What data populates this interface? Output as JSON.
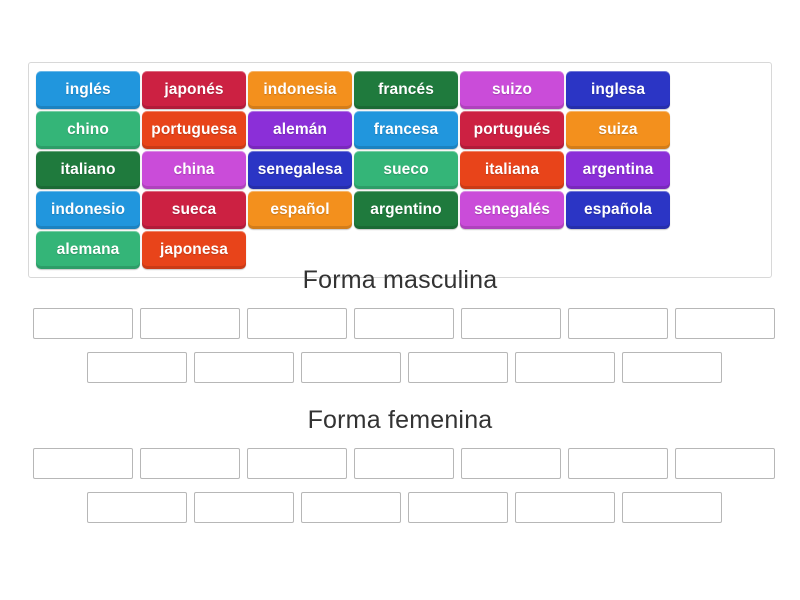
{
  "wordbank": {
    "name": "word-bank",
    "tiles": [
      {
        "label": "inglés",
        "color": "#2196dd"
      },
      {
        "label": "japonés",
        "color": "#cc2142"
      },
      {
        "label": "indonesia",
        "color": "#f3901d"
      },
      {
        "label": "francés",
        "color": "#1f7a3d"
      },
      {
        "label": "suizo",
        "color": "#ca4cd9"
      },
      {
        "label": "inglesa",
        "color": "#2b35c5"
      },
      {
        "label": "chino",
        "color": "#34b578"
      },
      {
        "label": "portuguesa",
        "color": "#e8441a"
      },
      {
        "label": "alemán",
        "color": "#8b2fd8"
      },
      {
        "label": "francesa",
        "color": "#2196dd"
      },
      {
        "label": "portugués",
        "color": "#cc2142"
      },
      {
        "label": "suiza",
        "color": "#f3901d"
      },
      {
        "label": "italiano",
        "color": "#1f7a3d"
      },
      {
        "label": "china",
        "color": "#ca4cd9"
      },
      {
        "label": "senegalesa",
        "color": "#2b35c5"
      },
      {
        "label": "sueco",
        "color": "#34b578"
      },
      {
        "label": "italiana",
        "color": "#e8441a"
      },
      {
        "label": "argentina",
        "color": "#8b2fd8"
      },
      {
        "label": "indonesio",
        "color": "#2196dd"
      },
      {
        "label": "sueca",
        "color": "#cc2142"
      },
      {
        "label": "español",
        "color": "#f3901d"
      },
      {
        "label": "argentino",
        "color": "#1f7a3d"
      },
      {
        "label": "senegalés",
        "color": "#ca4cd9"
      },
      {
        "label": "española",
        "color": "#2b35c5"
      },
      {
        "label": "alemana",
        "color": "#34b578"
      },
      {
        "label": "japonesa",
        "color": "#e8441a"
      }
    ]
  },
  "groups": [
    {
      "title": "Forma masculina",
      "row1_slots": [
        "",
        "",
        "",
        "",
        "",
        "",
        ""
      ],
      "row2_slots": [
        "",
        "",
        "",
        "",
        "",
        ""
      ]
    },
    {
      "title": "Forma femenina",
      "row1_slots": [
        "",
        "",
        "",
        "",
        "",
        "",
        ""
      ],
      "row2_slots": [
        "",
        "",
        "",
        "",
        "",
        ""
      ]
    }
  ]
}
